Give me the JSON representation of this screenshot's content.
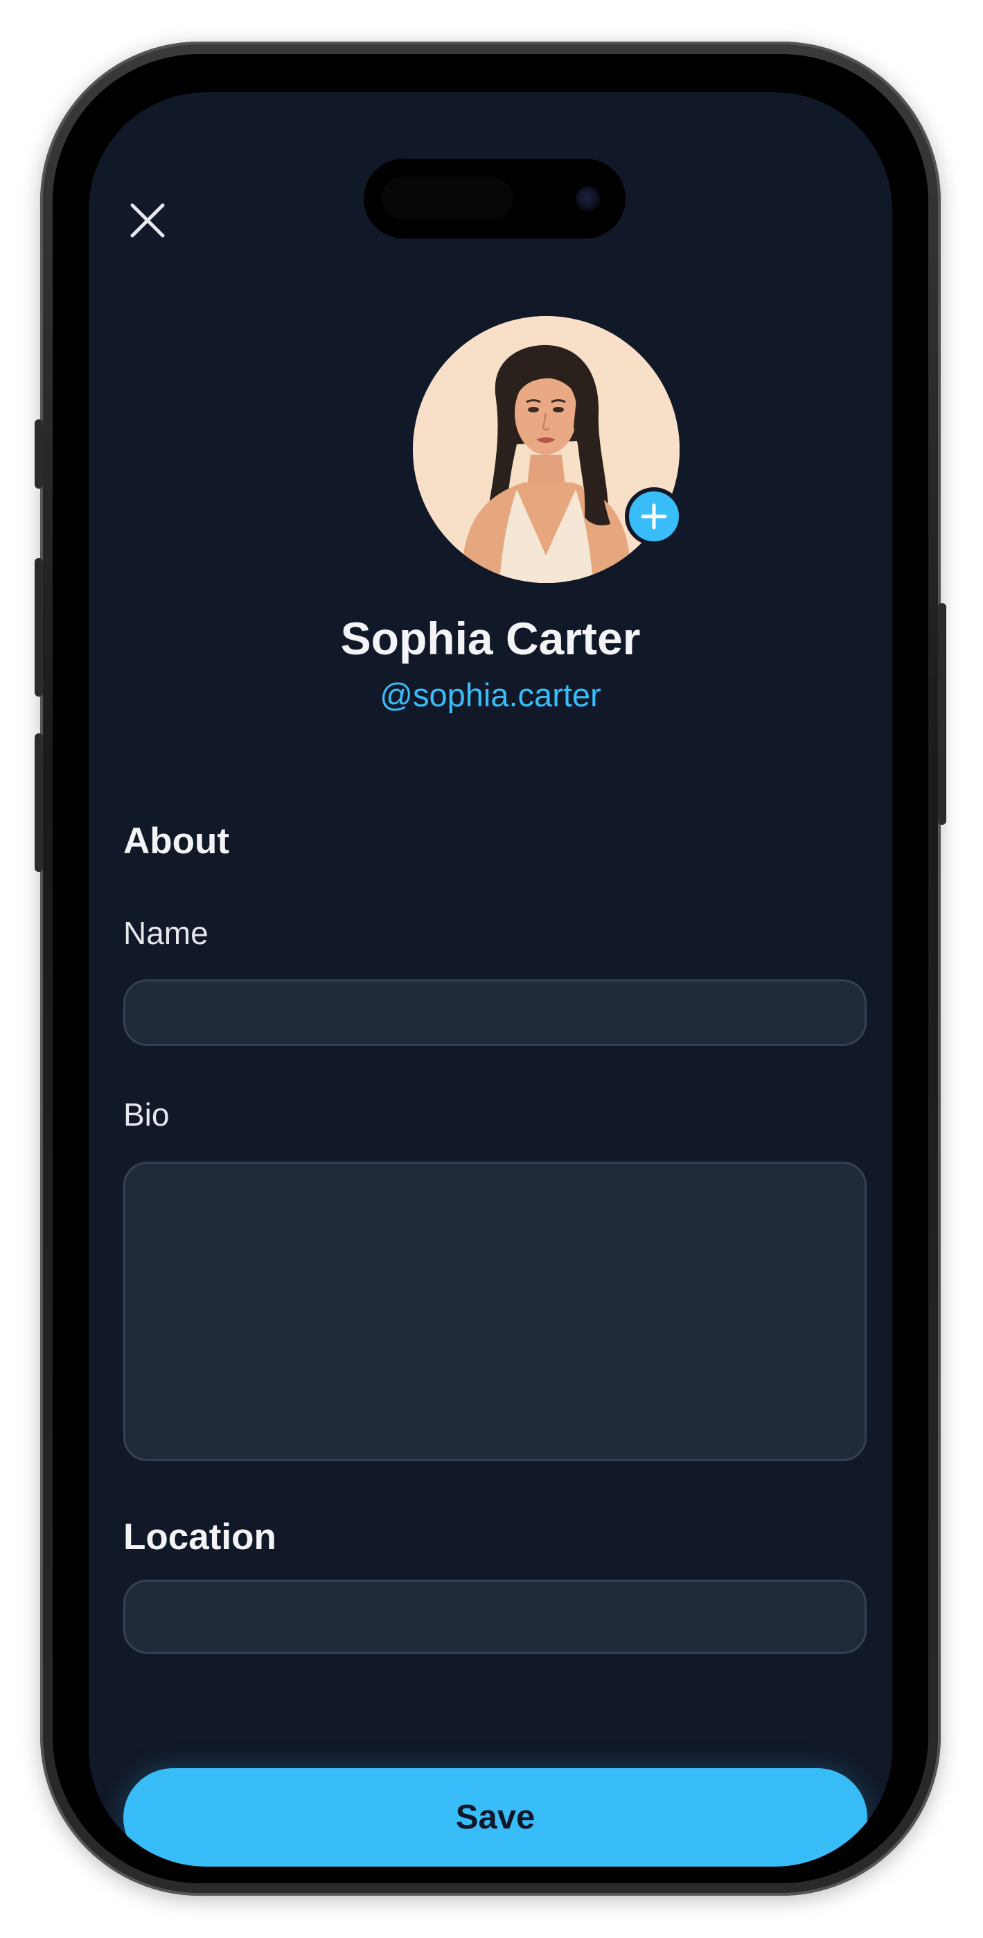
{
  "profile": {
    "name": "Sophia Carter",
    "handle": "@sophia.carter"
  },
  "about": {
    "title": "About",
    "name_label": "Name",
    "name_value": "",
    "bio_label": "Bio",
    "bio_value": ""
  },
  "location": {
    "title": "Location",
    "value": ""
  },
  "actions": {
    "save_label": "Save"
  },
  "icons": {
    "close": "close-icon",
    "add_photo": "plus-icon"
  },
  "colors": {
    "background": "#111827",
    "accent": "#38bdf8",
    "field_bg": "#202939",
    "field_border": "#334155",
    "text_primary": "#f3f4f6"
  }
}
